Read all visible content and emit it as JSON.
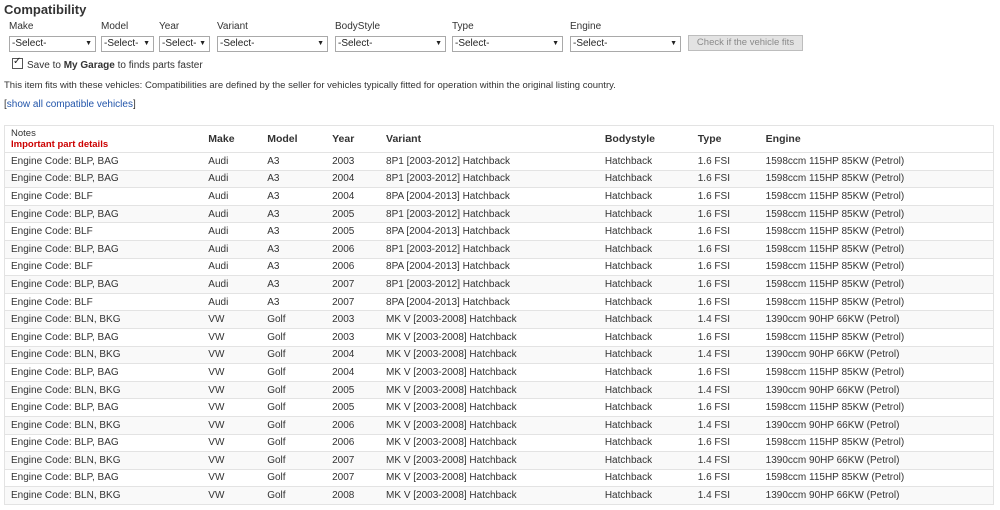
{
  "title": "Compatibility",
  "filters": [
    {
      "label": "Make",
      "value": "-Select-"
    },
    {
      "label": "Model",
      "value": "-Select-"
    },
    {
      "label": "Year",
      "value": "-Select-"
    },
    {
      "label": "Variant",
      "value": "-Select-"
    },
    {
      "label": "BodyStyle",
      "value": "-Select-"
    },
    {
      "label": "Type",
      "value": "-Select-"
    },
    {
      "label": "Engine",
      "value": "-Select-"
    }
  ],
  "check_button": "Check if the vehicle fits",
  "garage": {
    "prefix": "Save to ",
    "bold": "My Garage",
    "suffix": " to finds parts faster",
    "checked": true
  },
  "fits_text": "This item fits with these vehicles: Compatibilities are defined by the seller for vehicles typically fitted for operation within the original listing country.",
  "show_all": {
    "open": "[",
    "link": "show all compatible vehicles",
    "close": "]"
  },
  "table": {
    "headers": {
      "notes": "Notes",
      "important": "Important part details",
      "make": "Make",
      "model": "Model",
      "year": "Year",
      "variant": "Variant",
      "bodystyle": "Bodystyle",
      "type": "Type",
      "engine": "Engine"
    },
    "rows": [
      [
        "Engine Code: BLP, BAG",
        "Audi",
        "A3",
        "2003",
        "8P1 [2003-2012] Hatchback",
        "Hatchback",
        "1.6 FSI",
        "1598ccm 115HP 85KW (Petrol)"
      ],
      [
        "Engine Code: BLP, BAG",
        "Audi",
        "A3",
        "2004",
        "8P1 [2003-2012] Hatchback",
        "Hatchback",
        "1.6 FSI",
        "1598ccm 115HP 85KW (Petrol)"
      ],
      [
        "Engine Code: BLF",
        "Audi",
        "A3",
        "2004",
        "8PA [2004-2013] Hatchback",
        "Hatchback",
        "1.6 FSI",
        "1598ccm 115HP 85KW (Petrol)"
      ],
      [
        "Engine Code: BLP, BAG",
        "Audi",
        "A3",
        "2005",
        "8P1 [2003-2012] Hatchback",
        "Hatchback",
        "1.6 FSI",
        "1598ccm 115HP 85KW (Petrol)"
      ],
      [
        "Engine Code: BLF",
        "Audi",
        "A3",
        "2005",
        "8PA [2004-2013] Hatchback",
        "Hatchback",
        "1.6 FSI",
        "1598ccm 115HP 85KW (Petrol)"
      ],
      [
        "Engine Code: BLP, BAG",
        "Audi",
        "A3",
        "2006",
        "8P1 [2003-2012] Hatchback",
        "Hatchback",
        "1.6 FSI",
        "1598ccm 115HP 85KW (Petrol)"
      ],
      [
        "Engine Code: BLF",
        "Audi",
        "A3",
        "2006",
        "8PA [2004-2013] Hatchback",
        "Hatchback",
        "1.6 FSI",
        "1598ccm 115HP 85KW (Petrol)"
      ],
      [
        "Engine Code: BLP, BAG",
        "Audi",
        "A3",
        "2007",
        "8P1 [2003-2012] Hatchback",
        "Hatchback",
        "1.6 FSI",
        "1598ccm 115HP 85KW (Petrol)"
      ],
      [
        "Engine Code: BLF",
        "Audi",
        "A3",
        "2007",
        "8PA [2004-2013] Hatchback",
        "Hatchback",
        "1.6 FSI",
        "1598ccm 115HP 85KW (Petrol)"
      ],
      [
        "Engine Code: BLN, BKG",
        "VW",
        "Golf",
        "2003",
        "MK V [2003-2008] Hatchback",
        "Hatchback",
        "1.4 FSI",
        "1390ccm 90HP 66KW (Petrol)"
      ],
      [
        "Engine Code: BLP, BAG",
        "VW",
        "Golf",
        "2003",
        "MK V [2003-2008] Hatchback",
        "Hatchback",
        "1.6 FSI",
        "1598ccm 115HP 85KW (Petrol)"
      ],
      [
        "Engine Code: BLN, BKG",
        "VW",
        "Golf",
        "2004",
        "MK V [2003-2008] Hatchback",
        "Hatchback",
        "1.4 FSI",
        "1390ccm 90HP 66KW (Petrol)"
      ],
      [
        "Engine Code: BLP, BAG",
        "VW",
        "Golf",
        "2004",
        "MK V [2003-2008] Hatchback",
        "Hatchback",
        "1.6 FSI",
        "1598ccm 115HP 85KW (Petrol)"
      ],
      [
        "Engine Code: BLN, BKG",
        "VW",
        "Golf",
        "2005",
        "MK V [2003-2008] Hatchback",
        "Hatchback",
        "1.4 FSI",
        "1390ccm 90HP 66KW (Petrol)"
      ],
      [
        "Engine Code: BLP, BAG",
        "VW",
        "Golf",
        "2005",
        "MK V [2003-2008] Hatchback",
        "Hatchback",
        "1.6 FSI",
        "1598ccm 115HP 85KW (Petrol)"
      ],
      [
        "Engine Code: BLN, BKG",
        "VW",
        "Golf",
        "2006",
        "MK V [2003-2008] Hatchback",
        "Hatchback",
        "1.4 FSI",
        "1390ccm 90HP 66KW (Petrol)"
      ],
      [
        "Engine Code: BLP, BAG",
        "VW",
        "Golf",
        "2006",
        "MK V [2003-2008] Hatchback",
        "Hatchback",
        "1.6 FSI",
        "1598ccm 115HP 85KW (Petrol)"
      ],
      [
        "Engine Code: BLN, BKG",
        "VW",
        "Golf",
        "2007",
        "MK V [2003-2008] Hatchback",
        "Hatchback",
        "1.4 FSI",
        "1390ccm 90HP 66KW (Petrol)"
      ],
      [
        "Engine Code: BLP, BAG",
        "VW",
        "Golf",
        "2007",
        "MK V [2003-2008] Hatchback",
        "Hatchback",
        "1.6 FSI",
        "1598ccm 115HP 85KW (Petrol)"
      ],
      [
        "Engine Code: BLN, BKG",
        "VW",
        "Golf",
        "2008",
        "MK V [2003-2008] Hatchback",
        "Hatchback",
        "1.4 FSI",
        "1390ccm 90HP 66KW (Petrol)"
      ]
    ]
  }
}
